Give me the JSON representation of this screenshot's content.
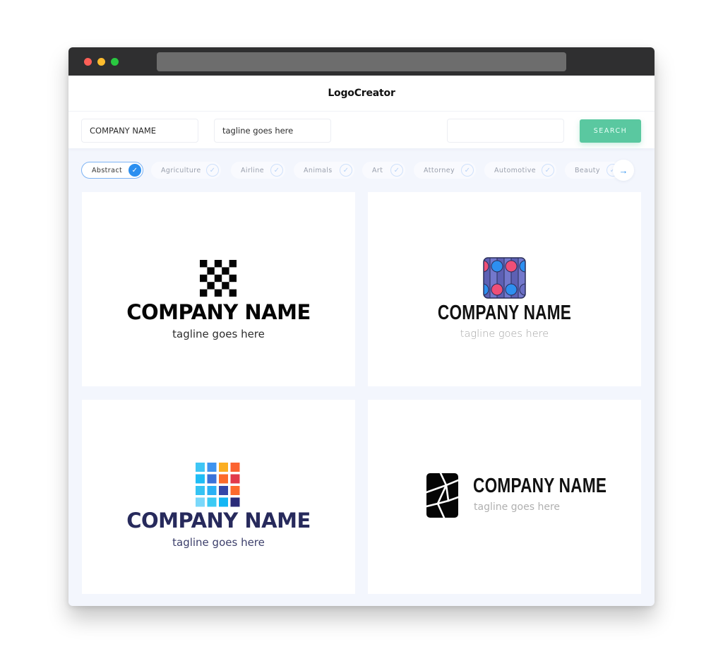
{
  "window": {
    "traffic_lights": [
      "close",
      "minimize",
      "maximize"
    ],
    "url": ""
  },
  "header": {
    "title": "LogoCreator"
  },
  "search": {
    "company_name_value": "COMPANY NAME",
    "tagline_value": "tagline goes here",
    "query_value": "",
    "button_label": "SEARCH"
  },
  "categories": {
    "items": [
      {
        "label": "Abstract",
        "selected": true
      },
      {
        "label": "Agriculture",
        "selected": false
      },
      {
        "label": "Airline",
        "selected": false
      },
      {
        "label": "Animals",
        "selected": false
      },
      {
        "label": "Art",
        "selected": false
      },
      {
        "label": "Attorney",
        "selected": false
      },
      {
        "label": "Automotive",
        "selected": false
      },
      {
        "label": "Beauty",
        "selected": false
      }
    ],
    "check_icon": "checkmark-icon",
    "next_icon": "arrow-right-icon"
  },
  "logos": [
    {
      "company": "COMPANY NAME",
      "tagline": "tagline goes here",
      "icon": "checkerboard-icon",
      "color": "#050505"
    },
    {
      "company": "COMPANY NAME",
      "tagline": "tagline goes here",
      "icon": "bead-columns-icon",
      "color": "#6b6fc4"
    },
    {
      "company": "COMPANY NAME",
      "tagline": "tagline goes here",
      "icon": "color-grid-icon",
      "color": "#272a5c"
    },
    {
      "company": "COMPANY NAME",
      "tagline": "tagline goes here",
      "icon": "cracked-tile-icon",
      "color": "#111111"
    }
  ],
  "colors": {
    "accent_blue": "#2b8ff0",
    "search_green": "#5ac8a0",
    "background": "#f3f6fd"
  }
}
